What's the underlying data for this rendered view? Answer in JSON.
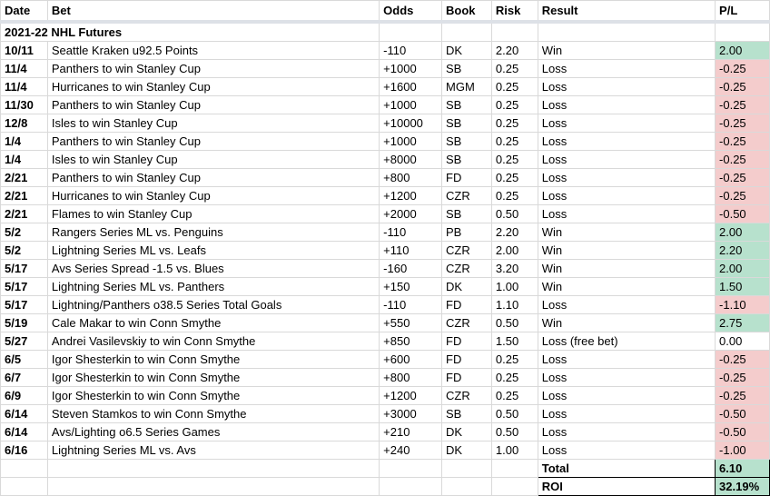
{
  "headers": {
    "date": "Date",
    "bet": "Bet",
    "odds": "Odds",
    "book": "Book",
    "risk": "Risk",
    "result": "Result",
    "pl": "P/L"
  },
  "section_title": "2021-22 NHL Futures",
  "rows": [
    {
      "date": "10/11",
      "bet": "Seattle Kraken u92.5 Points",
      "odds": "-110",
      "book": "DK",
      "risk": "2.20",
      "result": "Win",
      "pl": "2.00",
      "status": "pos"
    },
    {
      "date": "11/4",
      "bet": "Panthers to win Stanley Cup",
      "odds": "+1000",
      "book": "SB",
      "risk": "0.25",
      "result": "Loss",
      "pl": "-0.25",
      "status": "neg"
    },
    {
      "date": "11/4",
      "bet": "Hurricanes to win Stanley Cup",
      "odds": "+1600",
      "book": "MGM",
      "risk": "0.25",
      "result": "Loss",
      "pl": "-0.25",
      "status": "neg"
    },
    {
      "date": "11/30",
      "bet": "Panthers to win Stanley Cup",
      "odds": "+1000",
      "book": "SB",
      "risk": "0.25",
      "result": "Loss",
      "pl": "-0.25",
      "status": "neg"
    },
    {
      "date": "12/8",
      "bet": "Isles to win Stanley Cup",
      "odds": "+10000",
      "book": "SB",
      "risk": "0.25",
      "result": "Loss",
      "pl": "-0.25",
      "status": "neg"
    },
    {
      "date": "1/4",
      "bet": "Panthers to win Stanley Cup",
      "odds": "+1000",
      "book": "SB",
      "risk": "0.25",
      "result": "Loss",
      "pl": "-0.25",
      "status": "neg"
    },
    {
      "date": "1/4",
      "bet": "Isles to win Stanley Cup",
      "odds": "+8000",
      "book": "SB",
      "risk": "0.25",
      "result": "Loss",
      "pl": "-0.25",
      "status": "neg"
    },
    {
      "date": "2/21",
      "bet": "Panthers to win Stanley Cup",
      "odds": "+800",
      "book": "FD",
      "risk": "0.25",
      "result": "Loss",
      "pl": "-0.25",
      "status": "neg"
    },
    {
      "date": "2/21",
      "bet": "Hurricanes to win Stanley Cup",
      "odds": "+1200",
      "book": "CZR",
      "risk": "0.25",
      "result": "Loss",
      "pl": "-0.25",
      "status": "neg"
    },
    {
      "date": "2/21",
      "bet": "Flames to win Stanley Cup",
      "odds": "+2000",
      "book": "SB",
      "risk": "0.50",
      "result": "Loss",
      "pl": "-0.50",
      "status": "neg"
    },
    {
      "date": "5/2",
      "bet": "Rangers Series ML vs. Penguins",
      "odds": "-110",
      "book": "PB",
      "risk": "2.20",
      "result": "Win",
      "pl": "2.00",
      "status": "pos"
    },
    {
      "date": "5/2",
      "bet": "Lightning Series ML vs. Leafs",
      "odds": "+110",
      "book": "CZR",
      "risk": "2.00",
      "result": "Win",
      "pl": "2.20",
      "status": "pos"
    },
    {
      "date": "5/17",
      "bet": "Avs Series Spread -1.5 vs. Blues",
      "odds": "-160",
      "book": "CZR",
      "risk": "3.20",
      "result": "Win",
      "pl": "2.00",
      "status": "pos"
    },
    {
      "date": "5/17",
      "bet": "Lightning Series ML vs. Panthers",
      "odds": "+150",
      "book": "DK",
      "risk": "1.00",
      "result": "Win",
      "pl": "1.50",
      "status": "pos"
    },
    {
      "date": "5/17",
      "bet": "Lightning/Panthers o38.5 Series Total Goals",
      "odds": "-110",
      "book": "FD",
      "risk": "1.10",
      "result": "Loss",
      "pl": "-1.10",
      "status": "neg"
    },
    {
      "date": "5/19",
      "bet": "Cale Makar to win Conn Smythe",
      "odds": "+550",
      "book": "CZR",
      "risk": "0.50",
      "result": "Win",
      "pl": "2.75",
      "status": "pos"
    },
    {
      "date": "5/27",
      "bet": "Andrei Vasilevskiy to win Conn Smythe",
      "odds": "+850",
      "book": "FD",
      "risk": "1.50",
      "result": "Loss (free bet)",
      "pl": "0.00",
      "status": "none"
    },
    {
      "date": "6/5",
      "bet": "Igor Shesterkin to win Conn Smythe",
      "odds": "+600",
      "book": "FD",
      "risk": "0.25",
      "result": "Loss",
      "pl": "-0.25",
      "status": "neg"
    },
    {
      "date": "6/7",
      "bet": "Igor Shesterkin to win Conn Smythe",
      "odds": "+800",
      "book": "FD",
      "risk": "0.25",
      "result": "Loss",
      "pl": "-0.25",
      "status": "neg"
    },
    {
      "date": "6/9",
      "bet": "Igor Shesterkin to win Conn Smythe",
      "odds": "+1200",
      "book": "CZR",
      "risk": "0.25",
      "result": "Loss",
      "pl": "-0.25",
      "status": "neg"
    },
    {
      "date": "6/14",
      "bet": "Steven Stamkos to win Conn Smythe",
      "odds": "+3000",
      "book": "SB",
      "risk": "0.50",
      "result": "Loss",
      "pl": "-0.50",
      "status": "neg"
    },
    {
      "date": "6/14",
      "bet": "Avs/Lighting o6.5 Series Games",
      "odds": "+210",
      "book": "DK",
      "risk": "0.50",
      "result": "Loss",
      "pl": "-0.50",
      "status": "neg"
    },
    {
      "date": "6/16",
      "bet": "Lightning Series ML vs. Avs",
      "odds": "+240",
      "book": "DK",
      "risk": "1.00",
      "result": "Loss",
      "pl": "-1.00",
      "status": "neg"
    }
  ],
  "summary": {
    "total_label": "Total",
    "total_value": "6.10",
    "roi_label": "ROI",
    "roi_value": "32.19%"
  },
  "colors": {
    "win_fill": "#b7e1cd",
    "loss_fill": "#f4cccc"
  }
}
